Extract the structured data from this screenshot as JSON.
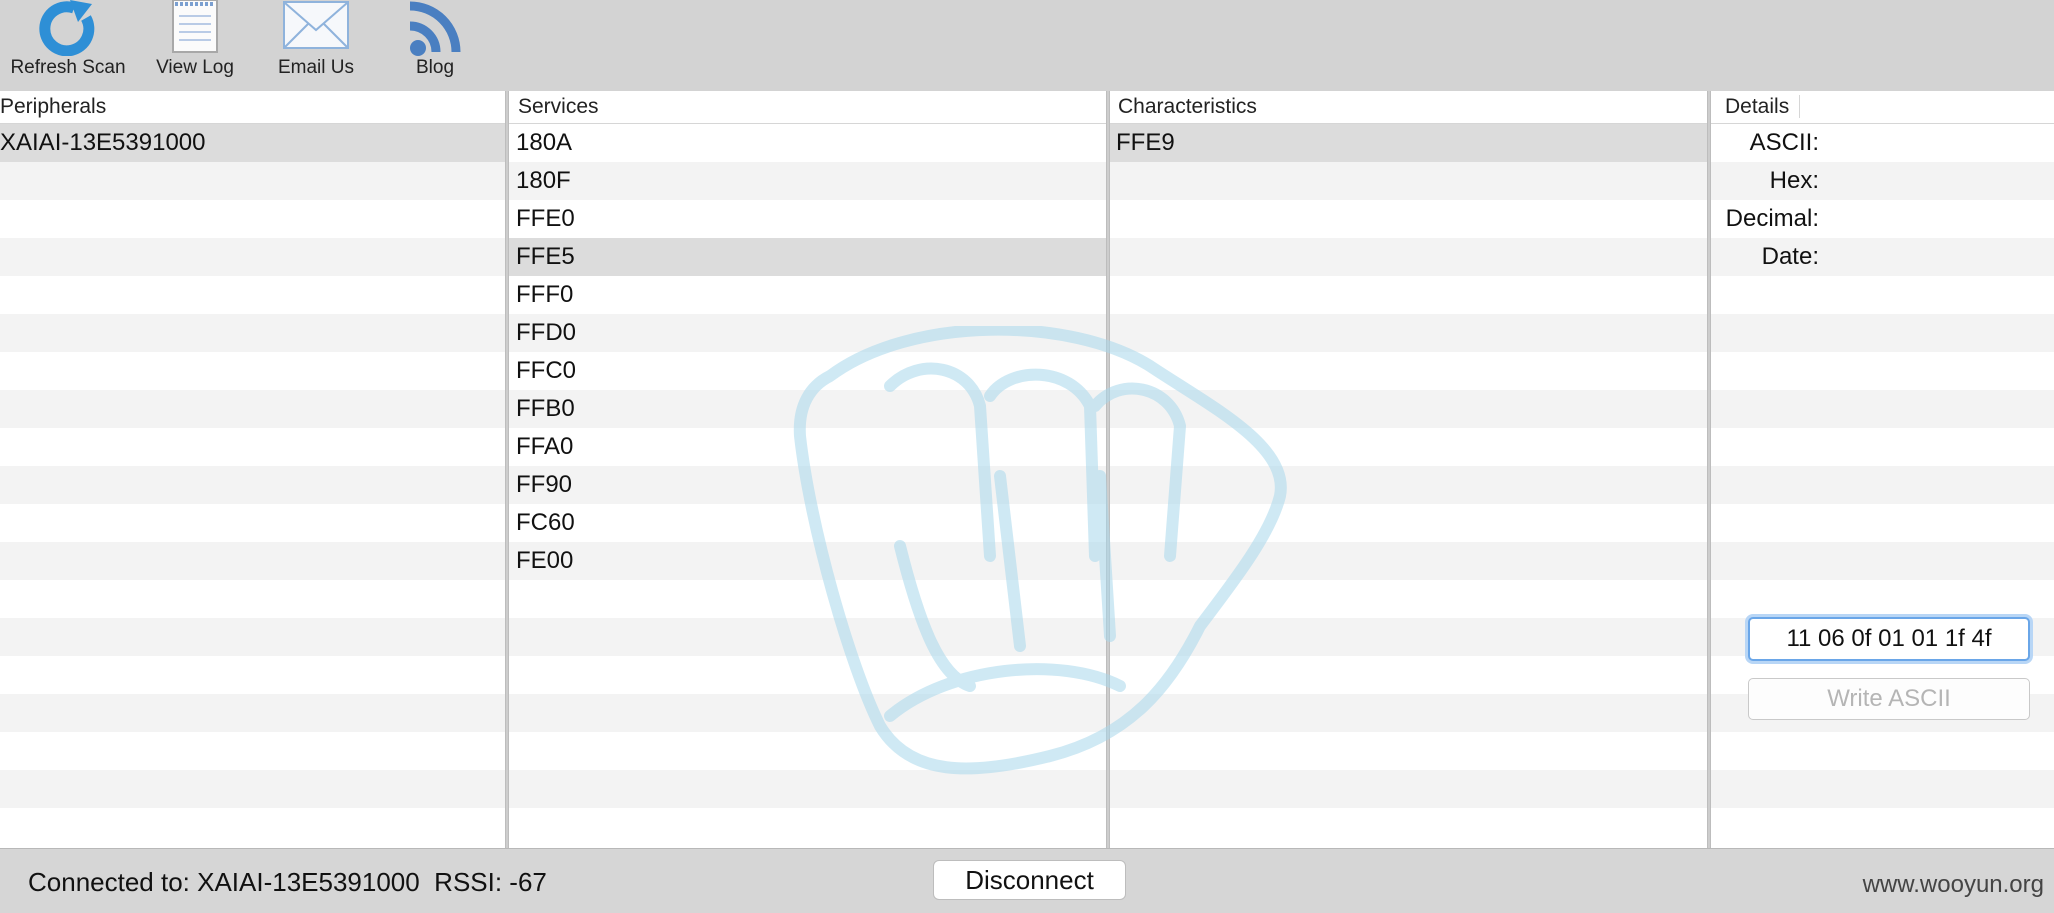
{
  "toolbar": {
    "buttons": [
      {
        "label": "Refresh Scan",
        "icon": "refresh-icon"
      },
      {
        "label": "View Log",
        "icon": "log-icon"
      },
      {
        "label": "Email Us",
        "icon": "envelope-icon"
      },
      {
        "label": "Blog",
        "icon": "rss-icon"
      }
    ]
  },
  "peripherals": {
    "header": "Peripherals",
    "items": [
      "XAIAI-13E5391000"
    ]
  },
  "services": {
    "header": "Services",
    "items": [
      "180A",
      "180F",
      "FFE0",
      "FFE5",
      "FFF0",
      "FFD0",
      "FFC0",
      "FFB0",
      "FFA0",
      "FF90",
      "FC60",
      "FE00"
    ],
    "selected": "FFE5"
  },
  "characteristics": {
    "header": "Characteristics",
    "items": [
      "FFE9"
    ]
  },
  "details": {
    "header": "Details",
    "ascii_label": "ASCII:",
    "hex_label": "Hex:",
    "decimal_label": "Decimal:",
    "date_label": "Date:",
    "value_input": "11 06 0f 01 01 1f 4f",
    "write_button": "Write ASCII"
  },
  "status": {
    "connected": "Connected to: XAIAI-13E5391000  RSSI: -67",
    "disconnect_button": "Disconnect",
    "site": "www.wooyun.org"
  },
  "colors": {
    "toolbar_bg": "#d3d3d3",
    "accent": "#2e8fd6",
    "selected_row": "#dcdcdc"
  }
}
